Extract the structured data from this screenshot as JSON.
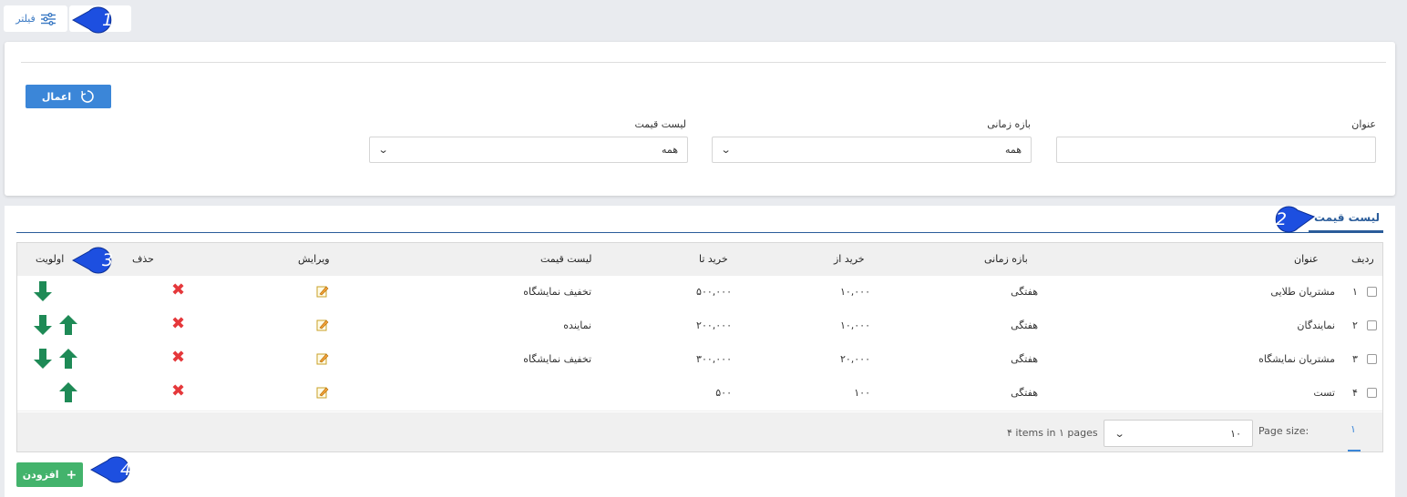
{
  "filter_toggle": {
    "label": "فیلتر",
    "icon": "sliders-icon"
  },
  "filter": {
    "apply_label": "اعمال",
    "fields": {
      "title": {
        "label": "عنوان",
        "value": ""
      },
      "period": {
        "label": "بازه زمانی",
        "value": "همه"
      },
      "price_list": {
        "label": "لیست قیمت",
        "value": "همه"
      }
    }
  },
  "tab": {
    "label": "لیست قیمت"
  },
  "table": {
    "headers": {
      "row_no": "ردیف",
      "title": "عنوان",
      "period": "بازه زمانی",
      "buy_from": "خرید از",
      "buy_to": "خرید تا",
      "price_list": "لیست قیمت",
      "edit": "ویرایش",
      "delete": "حذف",
      "priority": "اولویت"
    },
    "rows": [
      {
        "no": "۱",
        "title": "مشتریان طلایی",
        "period": "هفتگی",
        "buy_from": "۱۰,۰۰۰",
        "buy_to": "۵۰۰,۰۰۰",
        "price_list": "تخفیف نمایشگاه",
        "up": false,
        "down": true
      },
      {
        "no": "۲",
        "title": "نمایندگان",
        "period": "هفتگی",
        "buy_from": "۱۰,۰۰۰",
        "buy_to": "۲۰۰,۰۰۰",
        "price_list": "نماینده",
        "up": true,
        "down": true
      },
      {
        "no": "۳",
        "title": "مشتریان نمایشگاه",
        "period": "هفتگی",
        "buy_from": "۲۰,۰۰۰",
        "buy_to": "۳۰۰,۰۰۰",
        "price_list": "تخفیف نمایشگاه",
        "up": true,
        "down": true
      },
      {
        "no": "۴",
        "title": "تست",
        "period": "هفتگی",
        "buy_from": "۱۰۰",
        "buy_to": "۵۰۰",
        "price_list": "",
        "up": true,
        "down": false
      }
    ]
  },
  "pager": {
    "page": "۱",
    "page_size_label": "Page size:",
    "page_size_value": "۱۰",
    "summary": "۴ items in ۱ pages"
  },
  "add_button": {
    "label": "افزودن"
  },
  "markers": [
    "1",
    "2",
    "3",
    "4"
  ],
  "colors": {
    "accent": "#3b86d8",
    "add": "#43b36c",
    "delete": "#e5383b",
    "arrow": "#1e8a56",
    "marker": "#1d4fe0"
  }
}
